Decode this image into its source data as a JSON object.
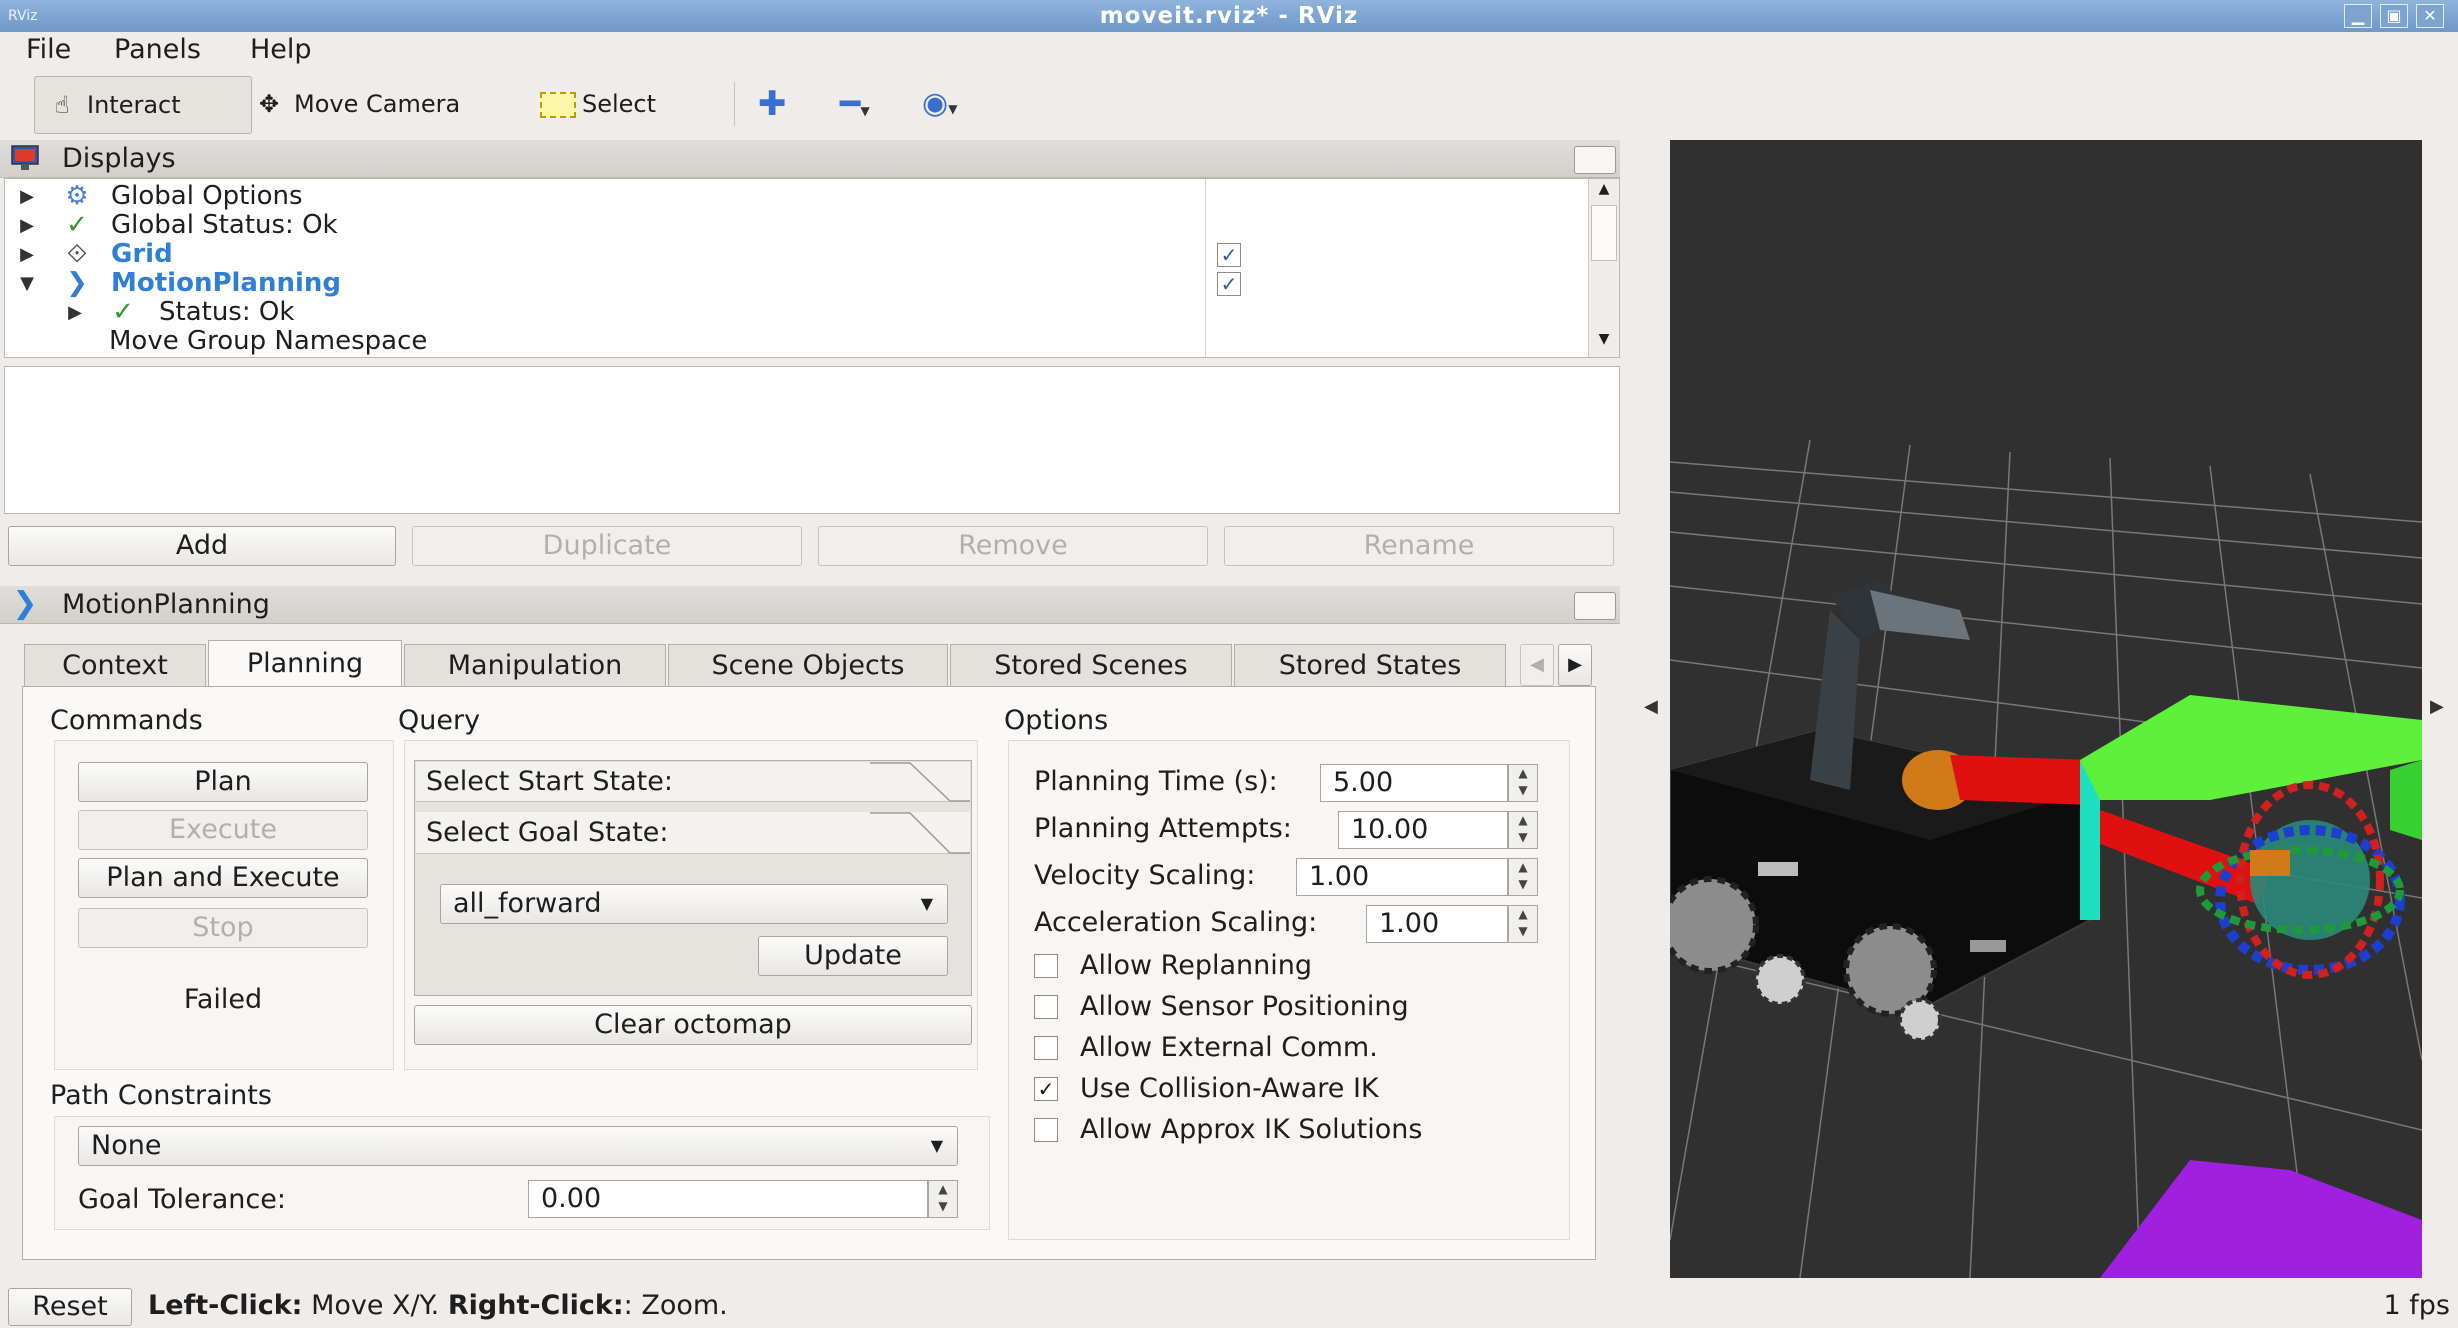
{
  "window": {
    "title": "moveit.rviz* - RViz",
    "app_badge": "RViz"
  },
  "menu": {
    "items": [
      "File",
      "Panels",
      "Help"
    ]
  },
  "toolbar": {
    "interact": "Interact",
    "move_camera": "Move Camera",
    "select": "Select"
  },
  "displays": {
    "title": "Displays",
    "rows": [
      {
        "label": "Global Options"
      },
      {
        "label": "Global Status: Ok"
      },
      {
        "label": "Grid",
        "checked": true
      },
      {
        "label": "MotionPlanning",
        "checked": true
      },
      {
        "label": "Status: Ok"
      },
      {
        "label": "Move Group Namespace"
      }
    ],
    "buttons": {
      "add": "Add",
      "duplicate": "Duplicate",
      "remove": "Remove",
      "rename": "Rename"
    }
  },
  "motion_panel": {
    "title": "MotionPlanning",
    "tabs": [
      "Context",
      "Planning",
      "Manipulation",
      "Scene Objects",
      "Stored Scenes",
      "Stored States"
    ],
    "active_tab": "Planning",
    "commands": {
      "label": "Commands",
      "plan": "Plan",
      "execute": "Execute",
      "plan_and_execute": "Plan and Execute",
      "stop": "Stop",
      "status": "Failed"
    },
    "query": {
      "label": "Query",
      "start_state": "Select Start State:",
      "goal_state": "Select Goal State:",
      "goal_value": "all_forward",
      "update": "Update",
      "clear_octomap": "Clear octomap"
    },
    "options": {
      "label": "Options",
      "planning_time_label": "Planning Time (s):",
      "planning_time": "5.00",
      "planning_attempts_label": "Planning Attempts:",
      "planning_attempts": "10.00",
      "velocity_label": "Velocity Scaling:",
      "velocity": "1.00",
      "acceleration_label": "Acceleration Scaling:",
      "acceleration": "1.00",
      "checks": [
        {
          "label": "Allow Replanning",
          "checked": false
        },
        {
          "label": "Allow Sensor Positioning",
          "checked": false
        },
        {
          "label": "Allow External Comm.",
          "checked": false
        },
        {
          "label": "Use Collision-Aware IK",
          "checked": true
        },
        {
          "label": "Allow Approx IK Solutions",
          "checked": false
        }
      ]
    },
    "path_constraints": {
      "label": "Path Constraints",
      "value": "None",
      "goal_tolerance_label": "Goal Tolerance:",
      "goal_tolerance": "0.00"
    }
  },
  "status": {
    "reset": "Reset",
    "left_click": "Left-Click:",
    "left_action": "Move X/Y.",
    "right_click": "Right-Click:",
    "right_action": ": Zoom.",
    "fps": "1 fps"
  },
  "colors": {
    "accent_blue": "#2f7fd7",
    "check_green": "#2e9a2e",
    "viewport_bg": "#303030",
    "robot_red": "#e01010",
    "octomap_green": "#5ef03a",
    "octomap_purple": "#a020e0"
  }
}
